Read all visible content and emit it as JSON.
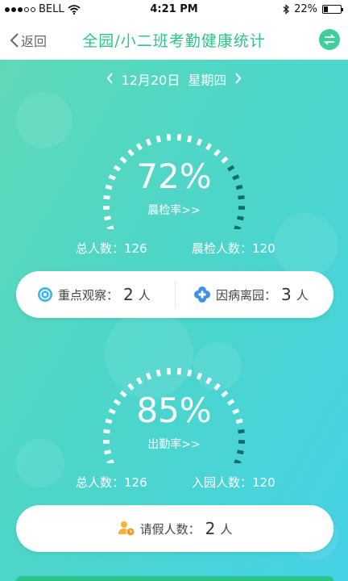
{
  "status_bar": {
    "carrier": "BELL",
    "time": "4:21 PM",
    "battery_text": "22%",
    "battery_level": 0.22,
    "icons": [
      "signal-dots-icon",
      "wifi-icon",
      "bluetooth-icon",
      "battery-icon"
    ]
  },
  "nav": {
    "back_label": "返回",
    "title": "全园/小二班考勤健康统计",
    "switch_icon": "swap-arrows-icon"
  },
  "date": {
    "label": "12月20日",
    "weekday": "星期四"
  },
  "morning_check": {
    "rate_text": "72%",
    "rate": 0.72,
    "label": "晨检率>>",
    "total_label": "总人数：",
    "total_value": "126",
    "checked_label": "晨检人数：",
    "checked_value": "120"
  },
  "observation_card": {
    "key_label": "重点观察：",
    "key_value": "2",
    "key_unit": "人",
    "sick_label": "因病离园：",
    "sick_value": "3",
    "sick_unit": "人"
  },
  "attendance": {
    "rate_text": "85%",
    "rate": 0.85,
    "label": "出勤率>>",
    "total_label": "总人数：",
    "total_value": "126",
    "entered_label": "入园人数：",
    "entered_value": "120"
  },
  "leave_card": {
    "label": "请假人数：",
    "value": "2",
    "unit": "人"
  },
  "colors": {
    "accent": "#2bc48a",
    "gradient_start": "#5fd9b8",
    "gradient_end": "#45d2e6",
    "gauge_done": "#ffffff",
    "gauge_todo": "#0f6b6b"
  }
}
